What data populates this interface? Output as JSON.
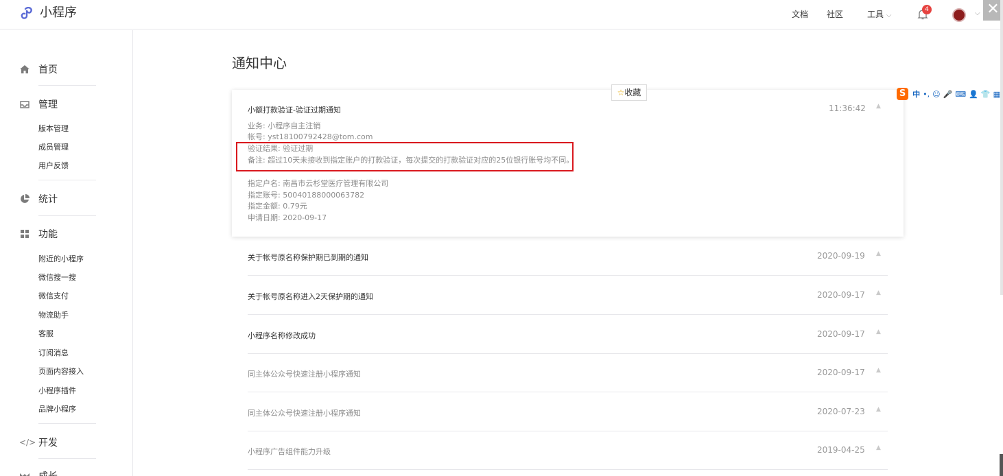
{
  "app": {
    "logo_text": "小程序"
  },
  "topnav": {
    "docs": "文档",
    "community": "社区",
    "tools": "工具",
    "tools_caret": "⌵",
    "notification_count": "4",
    "close": "✕"
  },
  "sidebar": {
    "home": "首页",
    "manage": "管理",
    "manage_items": [
      "版本管理",
      "成员管理",
      "用户反馈"
    ],
    "stats": "统计",
    "features": "功能",
    "feature_items": [
      "附近的小程序",
      "微信搜一搜",
      "微信支付",
      "物流助手",
      "客服",
      "订阅消息",
      "页面内容接入",
      "小程序插件",
      "品牌小程序"
    ],
    "develop": "开发",
    "growth": "成长"
  },
  "main": {
    "title": "通知中心",
    "favorite": "收藏",
    "expanded": {
      "title": "小额打款验证-验证过期通知",
      "time": "11:36:42",
      "lines": [
        "业务: 小程序自主注销",
        "帐号: yst18100792428@tom.com",
        "验证结果: 验证过期",
        "备注: 超过10天未接收到指定账户的打款验证，每次提交的打款验证对应的25位银行账号均不同。",
        "指定户名: 南昌市云杉堂医疗管理有限公司",
        "指定账号: 50040188000063782",
        "指定金额: 0.79元",
        "申请日期: 2020-09-17"
      ]
    },
    "notifications": [
      {
        "title": "关于帐号原名称保护期已到期的通知",
        "date": "2020-09-19"
      },
      {
        "title": "关于帐号原名称进入2天保护期的通知",
        "date": "2020-09-17"
      },
      {
        "title": "小程序名称修改成功",
        "date": "2020-09-17"
      },
      {
        "title": "同主体公众号快速注册小程序通知",
        "date": "2020-09-17"
      },
      {
        "title": "同主体公众号快速注册小程序通知",
        "date": "2020-07-23"
      },
      {
        "title": "小程序广告组件能力升级",
        "date": "2019-04-25"
      }
    ]
  },
  "ime": {
    "logo": "S",
    "mode": "中",
    "items": [
      "•,",
      "☺",
      "🎤",
      "⌨",
      "👤",
      "👕",
      "▦"
    ]
  },
  "colors": {
    "highlight_border": "#d9181e",
    "badge": "#e64340",
    "logo_brand": "#5b6bd6"
  }
}
